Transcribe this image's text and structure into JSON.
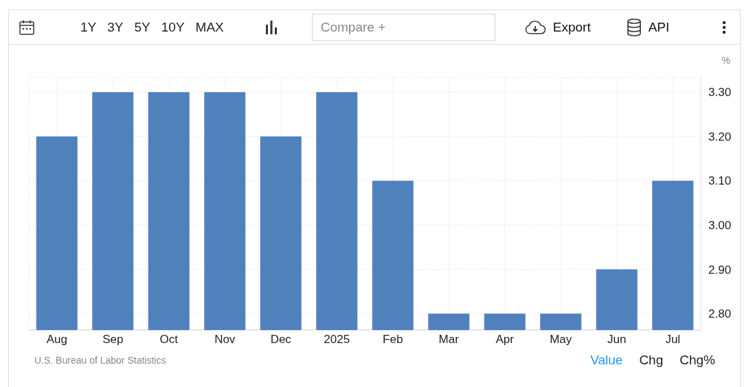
{
  "toolbar": {
    "ranges": [
      {
        "label": "1Y",
        "selected": false
      },
      {
        "label": "3Y",
        "selected": false
      },
      {
        "label": "5Y",
        "selected": false
      },
      {
        "label": "10Y",
        "selected": false
      },
      {
        "label": "MAX",
        "selected": false
      }
    ],
    "compare": {
      "placeholder": "Compare +"
    },
    "export_label": "Export",
    "api_label": "API"
  },
  "chart": {
    "unit": "%",
    "chart_data": {
      "type": "bar",
      "categories": [
        "Aug",
        "Sep",
        "Oct",
        "Nov",
        "Dec",
        "2025",
        "Feb",
        "Mar",
        "Apr",
        "May",
        "Jun",
        "Jul"
      ],
      "grid": true,
      "series": [
        {
          "color": "#4f81bd",
          "values": [
            3.2,
            3.3,
            3.3,
            3.3,
            3.2,
            3.3,
            3.1,
            2.8,
            2.8,
            2.8,
            2.9,
            3.1
          ]
        }
      ],
      "ylim": [
        2.763,
        3.333
      ],
      "yticks": [
        {
          "value": 2.8,
          "label": "2.80"
        },
        {
          "value": 2.9,
          "label": "2.90"
        },
        {
          "value": 3.0,
          "label": "3.00"
        },
        {
          "value": 3.1,
          "label": "3.10"
        },
        {
          "value": 3.2,
          "label": "3.20"
        },
        {
          "value": 3.3,
          "label": "3.30"
        }
      ]
    }
  },
  "footer": {
    "source": "U.S. Bureau of Labor Statistics",
    "views": [
      {
        "label": "Value",
        "selected": true
      },
      {
        "label": "Chg",
        "selected": false
      },
      {
        "label": "Chg%",
        "selected": false
      }
    ]
  }
}
